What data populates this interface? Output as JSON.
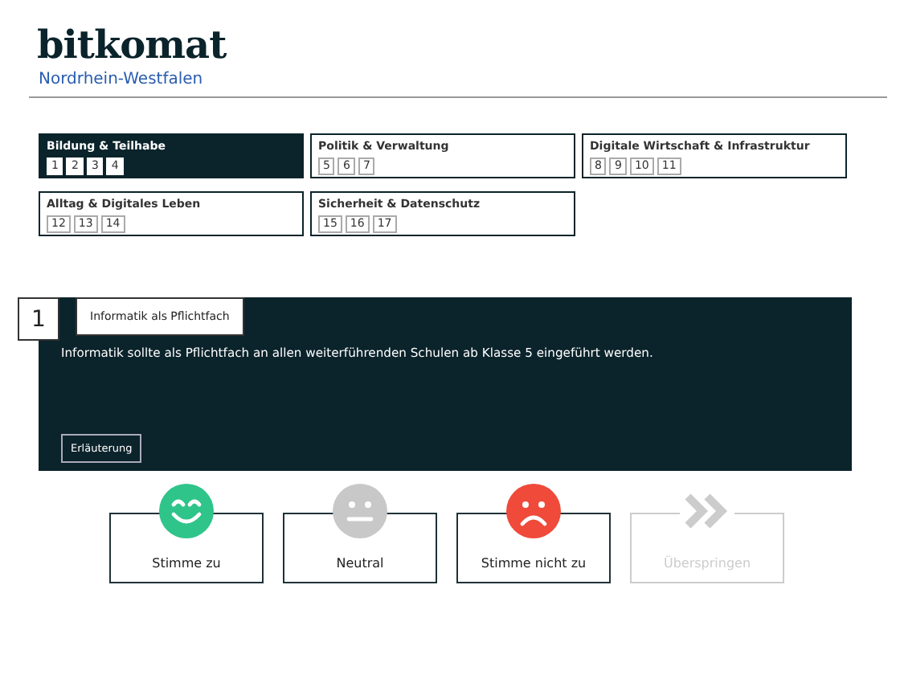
{
  "header": {
    "logo": "bitkomat",
    "region": "Nordrhein-Westfalen"
  },
  "categories": [
    {
      "title": "Bildung & Teilhabe",
      "selected": true,
      "numbers": [
        "1",
        "2",
        "3",
        "4"
      ]
    },
    {
      "title": "Politik & Verwaltung",
      "selected": false,
      "numbers": [
        "5",
        "6",
        "7"
      ]
    },
    {
      "title": "Digitale Wirtschaft & Infrastruktur",
      "selected": false,
      "numbers": [
        "8",
        "9",
        "10",
        "11"
      ]
    },
    {
      "title": "Alltag & Digitales Leben",
      "selected": false,
      "numbers": [
        "12",
        "13",
        "14"
      ]
    },
    {
      "title": "Sicherheit & Datenschutz",
      "selected": false,
      "numbers": [
        "15",
        "16",
        "17"
      ]
    }
  ],
  "question": {
    "number": "1",
    "topic": "Informatik als Pflichtfach",
    "statement": "Informatik sollte als Pflichtfach an allen weiterführenden Schulen ab Klasse 5 eingeführt werden.",
    "explain_button": "Erläuterung"
  },
  "answers": [
    {
      "kind": "agree",
      "label": "Stimme zu",
      "disabled": false
    },
    {
      "kind": "neutral",
      "label": "Neutral",
      "disabled": false
    },
    {
      "kind": "disagree",
      "label": "Stimme nicht zu",
      "disabled": false
    },
    {
      "kind": "skip",
      "label": "Überspringen",
      "disabled": true
    }
  ]
}
